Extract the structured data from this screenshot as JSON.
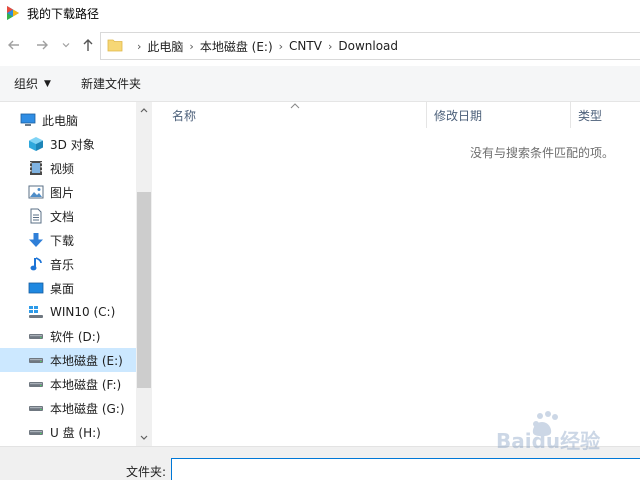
{
  "window": {
    "title": "我的下载路径"
  },
  "address": {
    "crumbs": [
      "此电脑",
      "本地磁盘 (E:)",
      "CNTV",
      "Download"
    ]
  },
  "toolbar": {
    "organize_label": "组织",
    "new_folder_label": "新建文件夹"
  },
  "nav": {
    "items": [
      {
        "label": "此电脑",
        "icon": "computer-icon"
      },
      {
        "label": "3D 对象",
        "icon": "3d-objects-icon"
      },
      {
        "label": "视频",
        "icon": "video-icon"
      },
      {
        "label": "图片",
        "icon": "pictures-icon"
      },
      {
        "label": "文档",
        "icon": "documents-icon"
      },
      {
        "label": "下载",
        "icon": "download-icon"
      },
      {
        "label": "音乐",
        "icon": "music-icon"
      },
      {
        "label": "桌面",
        "icon": "desktop-icon"
      },
      {
        "label": "WIN10 (C:)",
        "icon": "windows-drive-icon"
      },
      {
        "label": "软件 (D:)",
        "icon": "drive-icon"
      },
      {
        "label": "本地磁盘 (E:)",
        "icon": "drive-icon",
        "selected": true
      },
      {
        "label": "本地磁盘 (F:)",
        "icon": "drive-icon"
      },
      {
        "label": "本地磁盘 (G:)",
        "icon": "drive-icon"
      },
      {
        "label": "U 盘 (H:)",
        "icon": "drive-icon"
      }
    ]
  },
  "files": {
    "columns": [
      "名称",
      "修改日期",
      "类型"
    ],
    "empty_message": "没有与搜索条件匹配的项。"
  },
  "footer": {
    "filename_label": "文件夹:",
    "filename_value": ""
  },
  "watermark": {
    "text": "Baidu经验"
  },
  "colors": {
    "selection": "#cce8ff",
    "accent": "#0078d7",
    "folder": "#f6d776"
  }
}
